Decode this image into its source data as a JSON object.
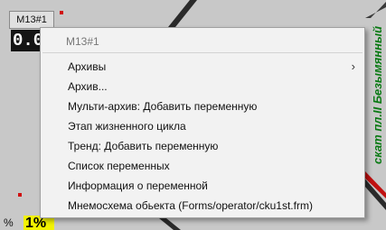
{
  "tag": {
    "name": "M13#1",
    "value": "0.0"
  },
  "percent": {
    "unit": "%",
    "value": "1%"
  },
  "side_label": "скат пл.II Безымянный",
  "context_menu": {
    "header": "M13#1",
    "items": [
      {
        "label": "Архивы",
        "has_submenu": true,
        "chevron": "›"
      },
      {
        "label": "Архив...",
        "has_submenu": false
      },
      {
        "label": "Мульти-архив: Добавить переменную",
        "has_submenu": false
      },
      {
        "label": "Этап жизненного цикла",
        "has_submenu": false
      },
      {
        "label": "Тренд: Добавить переменную",
        "has_submenu": false
      },
      {
        "label": "Список переменных",
        "has_submenu": false
      },
      {
        "label": "Информация о переменной",
        "has_submenu": false
      },
      {
        "label": "Мнемосхема обьекта (Forms/operator/cku1st.frm)",
        "has_submenu": false
      }
    ]
  },
  "colors": {
    "background": "#c8c8c8",
    "menu_background": "#f2f2f2",
    "side_label": "#0a7a14",
    "percent_box": "#f2f200",
    "indicator": "#d01010"
  }
}
